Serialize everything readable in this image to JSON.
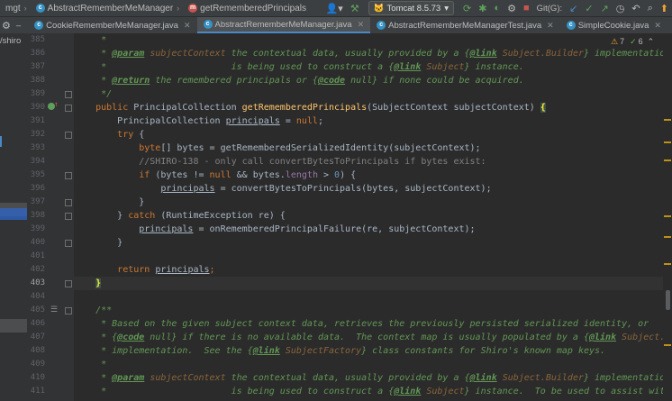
{
  "navbar": {
    "project_fragment": "mgt",
    "class_crumb": "AbstractRememberMeManager",
    "method_crumb": "getRememberedPrincipals",
    "run_config": "Tomcat 8.5.73",
    "git_label": "Git(G):"
  },
  "tabs": [
    {
      "label": "CookieRememberMeManager.java"
    },
    {
      "label": "AbstractRememberMeManager.java"
    },
    {
      "label": "AbstractRememberMeManagerTest.java"
    },
    {
      "label": "SimpleCookie.java"
    }
  ],
  "left_strip": {
    "project_path_fragment": "/shiro"
  },
  "inspections": {
    "warnings": "7",
    "ok": "6"
  },
  "gutter": {
    "line_numbers": [
      "385",
      "386",
      "387",
      "388",
      "389",
      "390",
      "391",
      "392",
      "393",
      "394",
      "395",
      "396",
      "397",
      "398",
      "399",
      "400",
      "401",
      "402",
      "403",
      "404",
      "405",
      "406",
      "407",
      "408",
      "409",
      "410",
      "411"
    ],
    "current_line": "403"
  },
  "code": {
    "l385_a": "     * ",
    "l386_tag": "@param",
    "l386_name": "subjectContext",
    "l386_doc1": " the contextual data, usually provided by a {",
    "l386_link": "@link",
    "l386_ref": "Subject.Builder",
    "l386_doc2": "} implementation, that",
    "l387_doc1": "     *                       is being used to construct a {",
    "l387_link": "@link",
    "l387_ref": "Subject",
    "l387_doc2": "} instance.",
    "l388_tag": "@return",
    "l388_doc1": " the remembered principals or {",
    "l388_code": "@code",
    "l388_doc2": " null} if none could be acquired.",
    "l389": "     */",
    "l390_kw": "public",
    "l390_type": " PrincipalCollection ",
    "l390_fn": "getRememberedPrincipals",
    "l390_rest": "(SubjectContext subjectContext) ",
    "l390_brace": "{",
    "l391_a": "        PrincipalCollection ",
    "l391_var": "principals",
    "l391_b": " = ",
    "l391_null": "null",
    "l391_c": ";",
    "l392_kw": "try",
    "l392_b": " {",
    "l393_kw": "byte",
    "l393_b": "[] bytes = getRememberedSerializedIdentity(subjectContext);",
    "l394_cmt": "//SHIRO-138 - only call convertBytesToPrincipals if bytes exist:",
    "l395_kw": "if",
    "l395_b": " (bytes != ",
    "l395_null": "null",
    "l395_c": " && bytes.",
    "l395_fld": "length",
    "l395_d": " > ",
    "l395_num": "0",
    "l395_e": ") {",
    "l396_var": "principals",
    "l396_b": " = convertBytesToPrincipals(bytes, subjectContext);",
    "l397": "            }",
    "l398_a": "        } ",
    "l398_kw": "catch",
    "l398_b": " (RuntimeException re) {",
    "l399_var": "principals",
    "l399_b": " = onRememberedPrincipalFailure(re, subjectContext);",
    "l400": "        }",
    "l402_kw": "return",
    "l402_var": "principals",
    "l402_c": ";",
    "l403_brace": "}",
    "l405": "    /**",
    "l406": "     * Based on the given subject context data, retrieves the previously persisted serialized identity, or",
    "l407_a": "     * {",
    "l407_code": "@code",
    "l407_b": " null} if there is no available data.  The context map is usually populated by a {",
    "l407_link": "@link",
    "l407_ref": "Subject.Builder",
    "l407_c": "}",
    "l408_a": "     * implementation.  See the {",
    "l408_link": "@link",
    "l408_ref": "SubjectFactory",
    "l408_b": "} class constants for Shiro's known map keys.",
    "l409": "     *",
    "l410_tag": "@param",
    "l410_name": "subjectContext",
    "l410_doc1": " the contextual data, usually provided by a {",
    "l410_link": "@link",
    "l410_ref": "Subject.Builder",
    "l410_doc2": "} implementation, that",
    "l411_doc1": "     *                       is being used to construct a {",
    "l411_link": "@link",
    "l411_ref": "Subject",
    "l411_doc2": "} instance.  To be used to assist with data"
  },
  "colors": {
    "editor_bg": "#2b2b2b",
    "gutter_bg": "#313335",
    "keyword": "#cc7832",
    "method": "#ffc66d",
    "doc_comment": "#629755",
    "line_comment": "#808080",
    "number": "#6897bb",
    "field": "#9876aa",
    "current_line": "#323232"
  }
}
